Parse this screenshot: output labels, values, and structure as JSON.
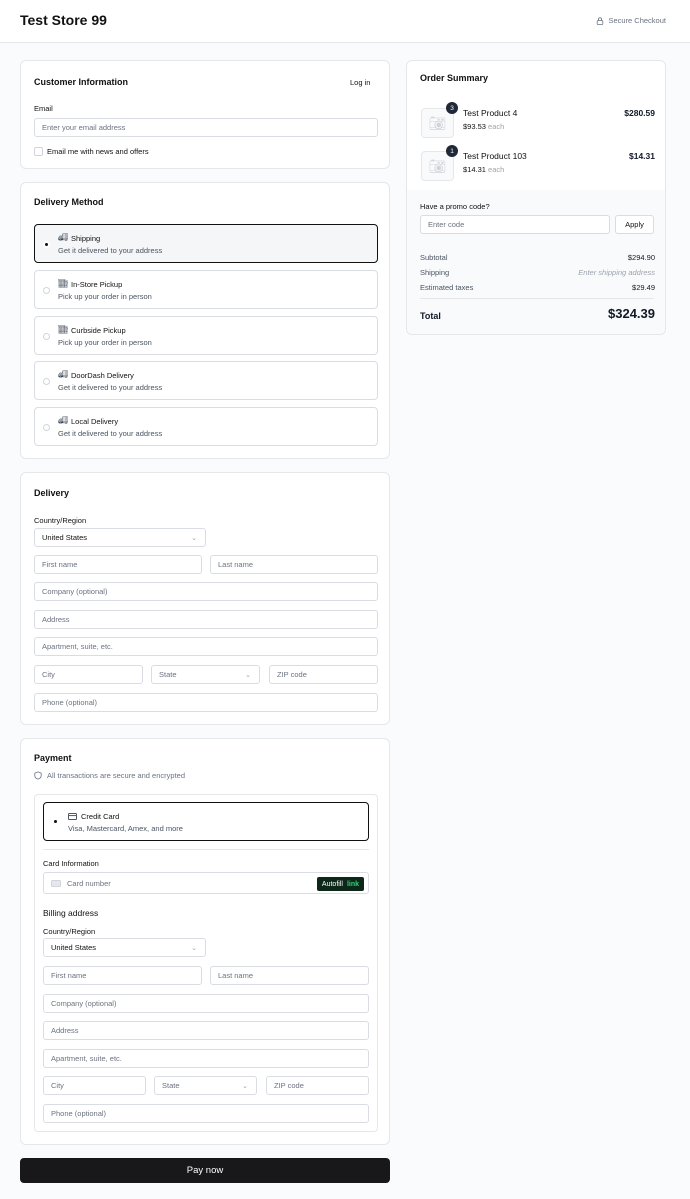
{
  "header": {
    "store_title": "Test Store 99",
    "secure_label": "Secure Checkout"
  },
  "customer": {
    "title": "Customer Information",
    "login_label": "Log in",
    "email_label": "Email",
    "email_placeholder": "Enter your email address",
    "newsletter_label": "Email me with news and offers"
  },
  "delivery_method": {
    "title": "Delivery Method",
    "options": [
      {
        "title": "Shipping",
        "subtitle": "Get it delivered to your address",
        "icon": "truck-icon",
        "selected": true
      },
      {
        "title": "In-Store Pickup",
        "subtitle": "Pick up your order in person",
        "icon": "store-icon",
        "selected": false
      },
      {
        "title": "Curbside Pickup",
        "subtitle": "Pick up your order in person",
        "icon": "store-icon",
        "selected": false
      },
      {
        "title": "DoorDash Delivery",
        "subtitle": "Get it delivered to your address",
        "icon": "truck-icon",
        "selected": false
      },
      {
        "title": "Local Delivery",
        "subtitle": "Get it delivered to your address",
        "icon": "truck-icon",
        "selected": false
      }
    ]
  },
  "delivery": {
    "title": "Delivery",
    "country_label": "Country/Region",
    "country_value": "United States",
    "first_name": "First name",
    "last_name": "Last name",
    "company": "Company (optional)",
    "address": "Address",
    "apartment": "Apartment, suite, etc.",
    "city": "City",
    "state": "State",
    "zip": "ZIP code",
    "phone": "Phone (optional)"
  },
  "payment": {
    "title": "Payment",
    "secure_note": "All transactions are secure and encrypted",
    "method_title": "Credit Card",
    "method_subtitle": "Visa, Mastercard, Amex, and more",
    "card_info_label": "Card Information",
    "card_number_placeholder": "Card number",
    "autofill_label": "Autofill",
    "autofill_link": "link",
    "billing_title": "Billing address",
    "country_label": "Country/Region",
    "country_value": "United States",
    "first_name": "First name",
    "last_name": "Last name",
    "company": "Company (optional)",
    "address": "Address",
    "apartment": "Apartment, suite, etc.",
    "city": "City",
    "state": "State",
    "zip": "ZIP code",
    "phone": "Phone (optional)"
  },
  "pay_button": "Pay now",
  "summary": {
    "title": "Order Summary",
    "items": [
      {
        "name": "Test Product 4",
        "qty": "3",
        "unit_price": "$93.53",
        "each": "each",
        "total": "$280.59"
      },
      {
        "name": "Test Product 103",
        "qty": "1",
        "unit_price": "$14.31",
        "each": "each",
        "total": "$14.31"
      }
    ],
    "promo_label": "Have a promo code?",
    "promo_placeholder": "Enter code",
    "apply_label": "Apply",
    "subtotal_label": "Subtotal",
    "subtotal_value": "$294.90",
    "shipping_label": "Shipping",
    "shipping_value": "Enter shipping address",
    "taxes_label": "Estimated taxes",
    "taxes_value": "$29.49",
    "total_label": "Total",
    "total_value": "$324.39"
  }
}
